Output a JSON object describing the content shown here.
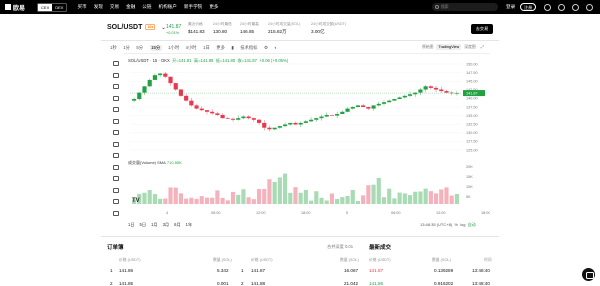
{
  "topbar": {
    "logo": "欧易",
    "mode_left": "CEX",
    "mode_right": "DEX",
    "nav": [
      "买币",
      "发现",
      "交易",
      "金融",
      "公链",
      "机构账户",
      "新手学院",
      "更多"
    ],
    "search_placeholder": "搜索",
    "login": "登录",
    "register": "注册"
  },
  "pair": {
    "name": "SOL/USDT",
    "badge": "10x"
  },
  "stats": [
    {
      "label": "",
      "value": "141.87",
      "sub": "+0.01%"
    },
    {
      "label": "最近价格",
      "value": "$141.83"
    },
    {
      "label": "24小时最低",
      "value": "130.80"
    },
    {
      "label": "24小时最高",
      "value": "146.85"
    },
    {
      "label": "24小时成交量(SOL)",
      "value": "215.82万"
    },
    {
      "label": "24小时成交额(USDT)",
      "value": "3.00亿"
    }
  ],
  "share": "去交易",
  "intervals": [
    "1秒",
    "1分",
    "5分",
    "15分",
    "1小时",
    "4小时",
    "1日",
    "1周",
    "1月",
    "更多"
  ],
  "interval_selected": 3,
  "tools_label": "技术指标",
  "chart_modes": [
    "原始图",
    "TradingView",
    "深度图"
  ],
  "chart_mode_selected": 1,
  "ohlc": {
    "pair": "SOL/USDT · 15 · OKX",
    "o": "开=141.81",
    "h": "高=141.89",
    "l": "低=141.80",
    "c": "收=141.87",
    "chg": "+0.06 (+0.05%)"
  },
  "volume_label": "成交量(Volume) SMA",
  "volume_value": "710.55K",
  "yticks": [
    "150.00",
    "147.50",
    "145.00",
    "142.50",
    "140.00",
    "137.50",
    "135.00",
    "132.50",
    "130.00",
    "127.50",
    "125.00"
  ],
  "vol_ticks": [
    "20K",
    "15K",
    "10K",
    "5K"
  ],
  "price_tag": "141.87",
  "xticks": [
    "4",
    "06:00",
    "12:00",
    "18:00",
    "5",
    "06:00",
    "12:00",
    "18:00",
    "09:0"
  ],
  "ranges": [
    "1日",
    "5日",
    "1月",
    "3月",
    "6月",
    "1年"
  ],
  "time_info": "13:48:35 (UTC+8)",
  "log_opts": [
    "%",
    "log",
    "自动"
  ],
  "orderbook": {
    "title": "订单簿",
    "merge": "合并深度",
    "merge_val": "0.01"
  },
  "trades": {
    "title": "最新成交"
  },
  "col_heads": {
    "price": "价格 (USDT)",
    "amount": "数量 (SOL)",
    "total": "累计 (SOL)",
    "time": "时间"
  },
  "asks": [
    {
      "idx": "1",
      "price": "141.86",
      "amount": "5.342"
    },
    {
      "idx": "2",
      "price": "141.85",
      "amount": "0.001"
    }
  ],
  "bids": [
    {
      "idx": "1",
      "price": "141.87",
      "amount": "16.067"
    },
    {
      "idx": "2",
      "price": "141.88",
      "amount": "21.042"
    }
  ],
  "trade_rows": [
    {
      "price": "141.87",
      "amount": "0.139289",
      "time": "13:48:40"
    },
    {
      "price": "141.86",
      "amount": "0.916202",
      "time": "13:48:40"
    }
  ],
  "chart_data": {
    "type": "candlestick",
    "title": "SOL/USDT · 15 · OKX",
    "ylim": [
      124,
      151
    ],
    "series": [
      {
        "name": "",
        "values": [
          140,
          142,
          144,
          146,
          147.5,
          148,
          147,
          145,
          143,
          141,
          139.5,
          138,
          137,
          136.5,
          136,
          135.5,
          135,
          134,
          133.8,
          133.5,
          134,
          134.5,
          134,
          133.5,
          132.5,
          131,
          130.5,
          131,
          131.5,
          132,
          132.5,
          132,
          132.5,
          133,
          133.5,
          134,
          134.5,
          135,
          134.8,
          135.3,
          136,
          137,
          137.5,
          138,
          137.5,
          137,
          138,
          138.5,
          139,
          139.5,
          140,
          140.5,
          141,
          141.5,
          142,
          143,
          144,
          143.5,
          143,
          142.5,
          142,
          141.8,
          141.87
        ]
      }
    ]
  }
}
